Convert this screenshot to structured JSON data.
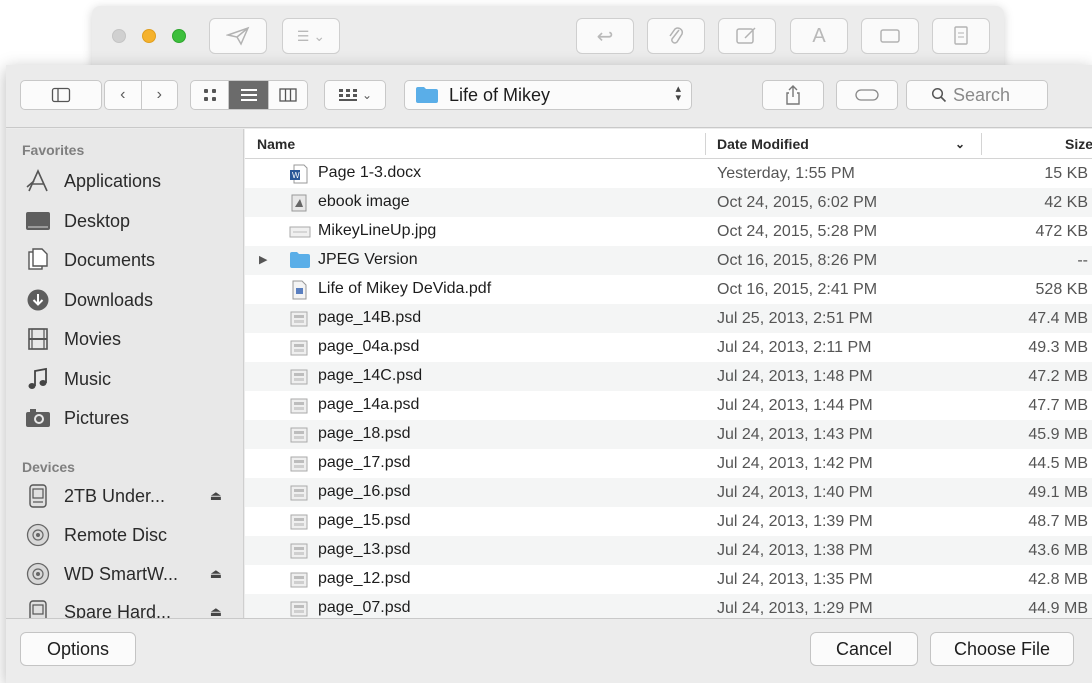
{
  "toolbar": {
    "location": "Life of Mikey",
    "search_placeholder": "Search"
  },
  "sidebar": {
    "favorites_header": "Favorites",
    "favorites": [
      {
        "label": "Applications",
        "icon": "applications-icon"
      },
      {
        "label": "Desktop",
        "icon": "desktop-icon"
      },
      {
        "label": "Documents",
        "icon": "documents-icon"
      },
      {
        "label": "Downloads",
        "icon": "downloads-icon"
      },
      {
        "label": "Movies",
        "icon": "movies-icon"
      },
      {
        "label": "Music",
        "icon": "music-icon"
      },
      {
        "label": "Pictures",
        "icon": "pictures-icon"
      }
    ],
    "devices_header": "Devices",
    "devices": [
      {
        "label": "2TB Under...",
        "icon": "hard-drive-icon",
        "eject": true
      },
      {
        "label": "Remote Disc",
        "icon": "disc-icon",
        "eject": false
      },
      {
        "label": "WD SmartW...",
        "icon": "disc-icon",
        "eject": true
      },
      {
        "label": "Spare Hard...",
        "icon": "hard-drive-icon",
        "eject": true
      }
    ]
  },
  "list": {
    "columns": {
      "name": "Name",
      "date": "Date Modified",
      "size": "Size"
    },
    "rows": [
      {
        "name": "Page 1-3.docx",
        "date": "Yesterday, 1:55 PM",
        "size": "15 KB",
        "icon": "word-document-icon"
      },
      {
        "name": "ebook image",
        "date": "Oct 24, 2015, 6:02 PM",
        "size": "42 KB",
        "icon": "image-file-icon"
      },
      {
        "name": "MikeyLineUp.jpg",
        "date": "Oct 24, 2015, 5:28 PM",
        "size": "472 KB",
        "icon": "jpg-file-icon"
      },
      {
        "name": "JPEG Version",
        "date": "Oct 16, 2015, 8:26 PM",
        "size": "--",
        "icon": "folder-icon",
        "folder": true
      },
      {
        "name": "Life of Mikey DeVida.pdf",
        "date": "Oct 16, 2015, 2:41 PM",
        "size": "528 KB",
        "icon": "pdf-file-icon"
      },
      {
        "name": "page_14B.psd",
        "date": "Jul 25, 2013, 2:51 PM",
        "size": "47.4 MB",
        "icon": "psd-file-icon"
      },
      {
        "name": "page_04a.psd",
        "date": "Jul 24, 2013, 2:11 PM",
        "size": "49.3 MB",
        "icon": "psd-file-icon"
      },
      {
        "name": "page_14C.psd",
        "date": "Jul 24, 2013, 1:48 PM",
        "size": "47.2 MB",
        "icon": "psd-file-icon"
      },
      {
        "name": "page_14a.psd",
        "date": "Jul 24, 2013, 1:44 PM",
        "size": "47.7 MB",
        "icon": "psd-file-icon"
      },
      {
        "name": "page_18.psd",
        "date": "Jul 24, 2013, 1:43 PM",
        "size": "45.9 MB",
        "icon": "psd-file-icon"
      },
      {
        "name": "page_17.psd",
        "date": "Jul 24, 2013, 1:42 PM",
        "size": "44.5 MB",
        "icon": "psd-file-icon"
      },
      {
        "name": "page_16.psd",
        "date": "Jul 24, 2013, 1:40 PM",
        "size": "49.1 MB",
        "icon": "psd-file-icon"
      },
      {
        "name": "page_15.psd",
        "date": "Jul 24, 2013, 1:39 PM",
        "size": "48.7 MB",
        "icon": "psd-file-icon"
      },
      {
        "name": "page_13.psd",
        "date": "Jul 24, 2013, 1:38 PM",
        "size": "43.6 MB",
        "icon": "psd-file-icon"
      },
      {
        "name": "page_12.psd",
        "date": "Jul 24, 2013, 1:35 PM",
        "size": "42.8 MB",
        "icon": "psd-file-icon"
      },
      {
        "name": "page_07.psd",
        "date": "Jul 24, 2013, 1:29 PM",
        "size": "44.9 MB",
        "icon": "psd-file-icon"
      }
    ]
  },
  "footer": {
    "options_label": "Options",
    "cancel_label": "Cancel",
    "choose_label": "Choose File"
  },
  "colors": {
    "folder": "#5aaee8",
    "word": "#2b5797",
    "pdf": "#d94a3a",
    "selected_view": "#6b6b6b"
  }
}
